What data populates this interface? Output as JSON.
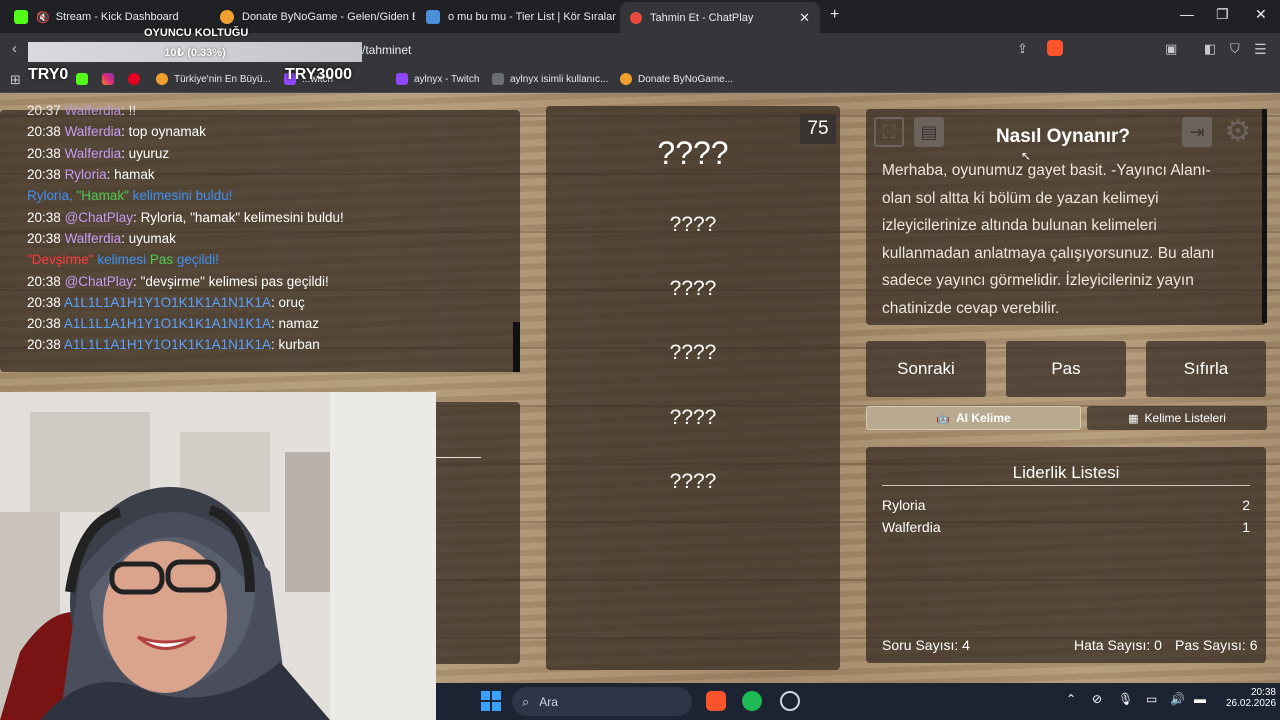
{
  "browser": {
    "tabs": [
      {
        "title": "Stream - Kick Dashboard",
        "icon": "kick-icon",
        "color": "#53fc18"
      },
      {
        "title": "Donate ByNoGame - Gelen/Giden Ba",
        "icon": "bynogame-icon",
        "color": "#f0a030"
      },
      {
        "title": "o mu bu mu - Tier List | Kör Sıralama",
        "icon": "tierlist-icon",
        "color": "#4a8fd8"
      },
      {
        "title": "Tahmin Et - ChatPlay",
        "icon": "chatplay-icon",
        "color": "#e84c3d"
      }
    ],
    "url": "/tahminet",
    "bookmarks": [
      {
        "label": "Türkiye'nin En Büyü...",
        "icon": "bynogame-icon"
      },
      {
        "label": "...witch",
        "icon": "twitch-icon"
      },
      {
        "label": "aylnyx - Twitch",
        "icon": "twitch-icon"
      },
      {
        "label": "aylnyx isimli kullanıc...",
        "icon": "doc-icon"
      },
      {
        "label": "Donate ByNoGame...",
        "icon": "bynogame-icon"
      }
    ]
  },
  "overlay": {
    "seat_label": "OYUNCU KOLTUĞU",
    "progress_label": "10₺ (0.33%)",
    "progress_fraction": 0.0033,
    "try0": "TRY0",
    "try3000": "TRY3000"
  },
  "chat": [
    {
      "time": "20:37",
      "user": "Walferdia",
      "user_color": "purple",
      "msg": "!!"
    },
    {
      "time": "20:38",
      "user": "Walferdia",
      "user_color": "purple",
      "msg": "top oynamak"
    },
    {
      "time": "20:38",
      "user": "Walferdia",
      "user_color": "purple",
      "msg": "uyuruz"
    },
    {
      "time": "20:38",
      "user": "Ryloria",
      "user_color": "purple",
      "msg": "hamak"
    },
    {
      "time": "",
      "system": [
        "Ryloria, ",
        "\"Hamak\"",
        " kelimesini buldu!"
      ]
    },
    {
      "time": "20:38",
      "user": "@ChatPlay",
      "user_color": "purple",
      "msg": "Ryloria, \"hamak\" kelimesini buldu!"
    },
    {
      "time": "20:38",
      "user": "Walferdia",
      "user_color": "purple",
      "msg": "uyumak"
    },
    {
      "time": "",
      "system": [
        "\"Devşirme\"",
        " kelimesi ",
        "Pas",
        " geçildi!"
      ]
    },
    {
      "time": "20:38",
      "user": "@ChatPlay",
      "user_color": "purple",
      "msg": "\"devşirme\" kelimesi pas geçildi!"
    },
    {
      "time": "20:38",
      "user": "A1L1L1A1H1Y1O1K1K1A1N1K1A",
      "user_color": "blue",
      "msg": "oruç"
    },
    {
      "time": "20:38",
      "user": "A1L1L1A1H1Y1O1K1K1A1N1K1A",
      "user_color": "blue",
      "msg": "namaz"
    },
    {
      "time": "20:38",
      "user": "A1L1L1A1H1Y1O1K1K1A1N1K1A",
      "user_color": "blue",
      "msg": "kurban"
    }
  ],
  "game": {
    "timer": "75",
    "words": [
      "????",
      "????",
      "????",
      "????",
      "????",
      "????"
    ],
    "howto_title": "Nasıl Oynanır?",
    "howto_text": "Merhaba, oyunumuz gayet basit. -Yayıncı Alanı- olan sol altta ki bölüm de yazan kelimeyi izleyicilerinize altında bulunan kelimeleri kullanmadan anlatmaya çalışıyorsunuz. Bu alanı sadece yayıncı görmelidir. İzleyicileriniz yayın chatinizde cevap verebilir.",
    "buttons": {
      "next": "Sonraki",
      "pass": "Pas",
      "reset": "Sıfırla"
    },
    "tab_ai": "AI Kelime",
    "tab_lists": "Kelime Listeleri",
    "leaderboard_title": "Liderlik Listesi",
    "leaderboard": [
      {
        "name": "Ryloria",
        "score": "2"
      },
      {
        "name": "Walferdia",
        "score": "1"
      }
    ],
    "stats": {
      "questions": "Soru Sayısı: 4",
      "errors": "Hata Sayısı: 0",
      "passes": "Pas Sayısı: 6"
    }
  },
  "taskbar": {
    "search": "Ara",
    "time": "20:38",
    "date": "26.02.2026"
  }
}
